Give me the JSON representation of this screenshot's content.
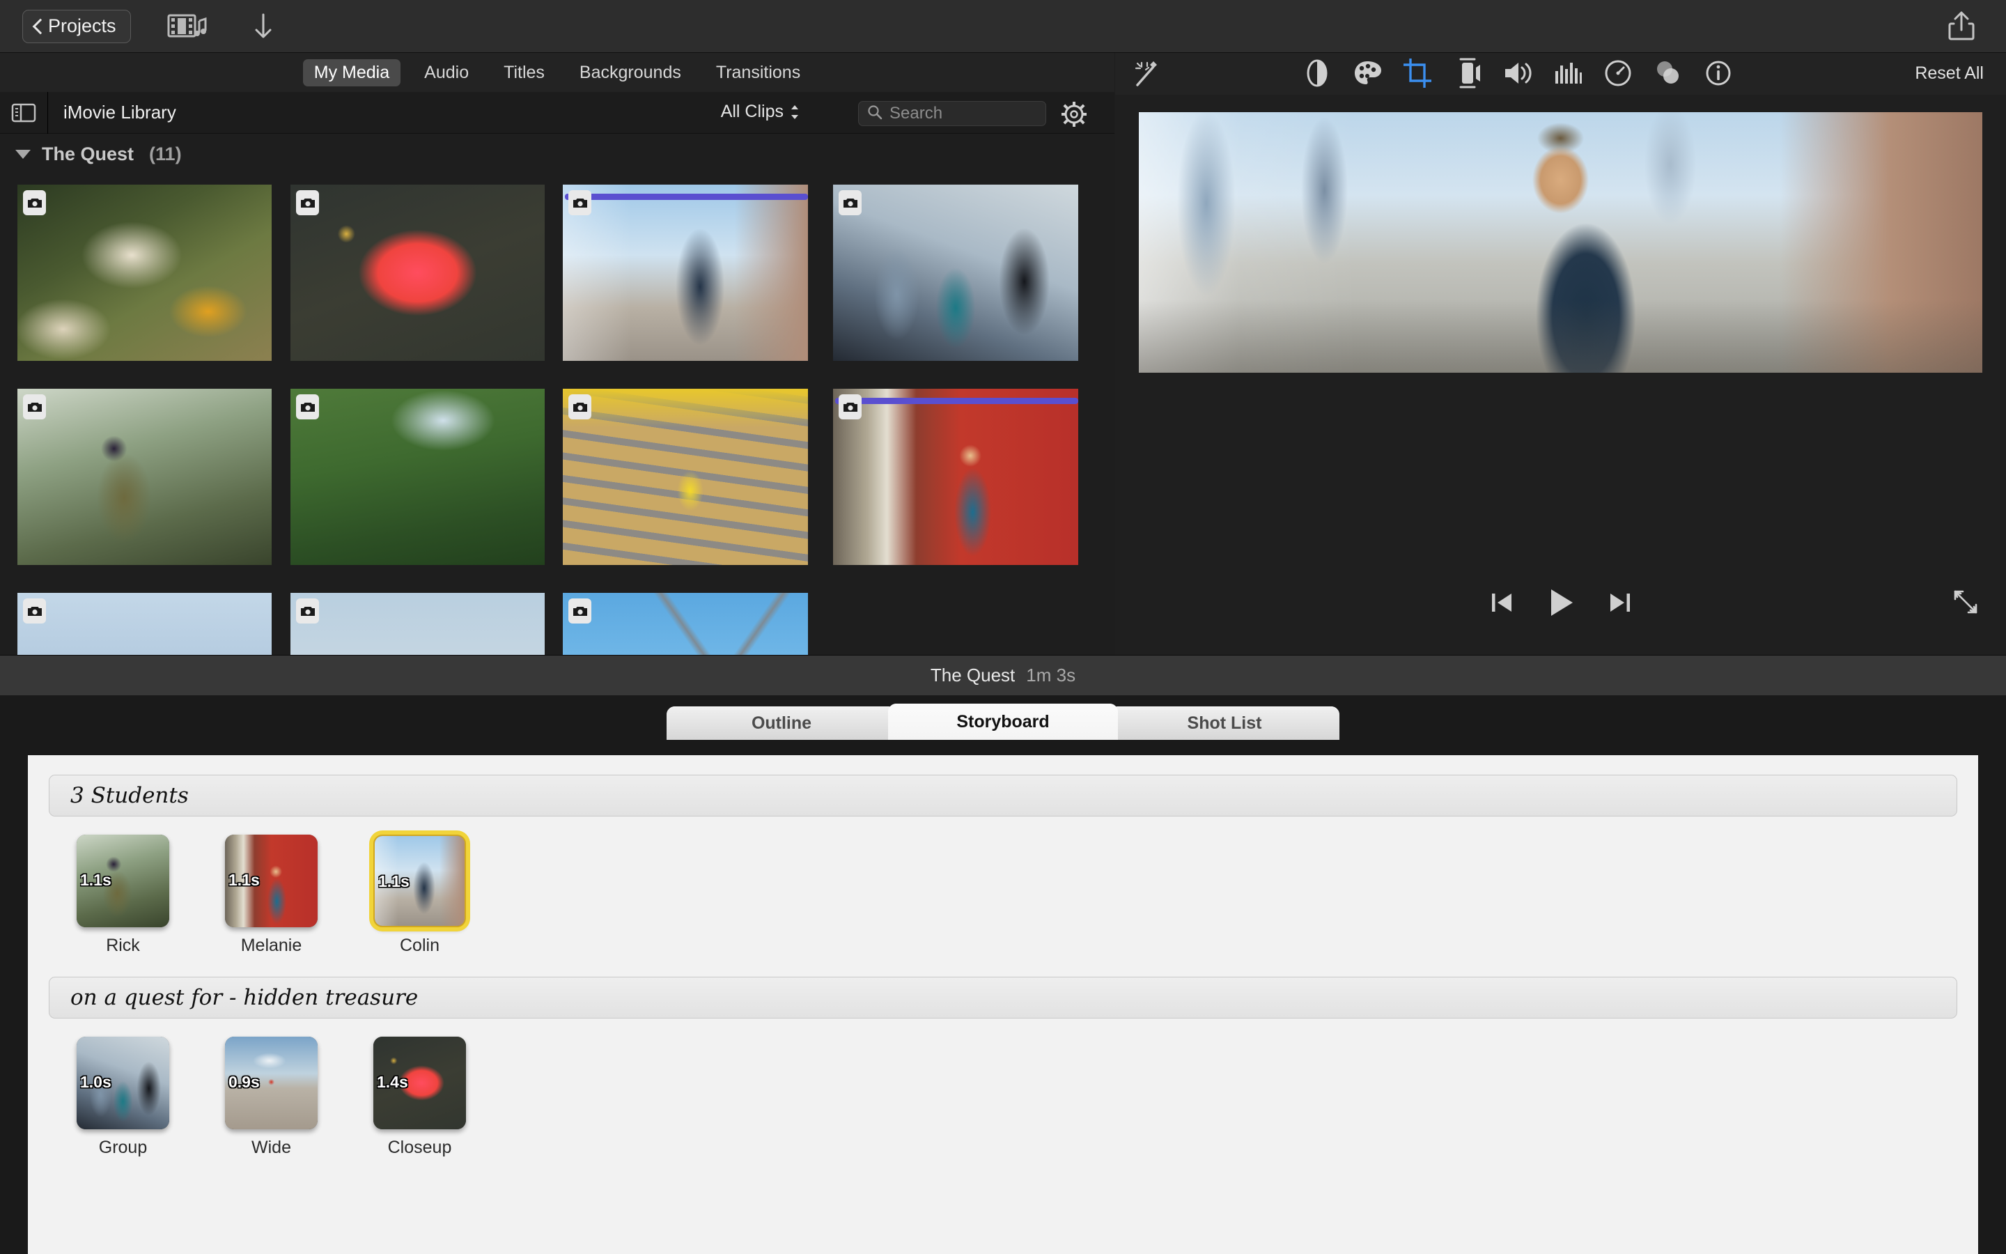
{
  "toolbar": {
    "back_label": "Projects",
    "icons": [
      "film-music-icon",
      "download-arrow-icon",
      "share-icon"
    ]
  },
  "browser": {
    "tabs": [
      {
        "label": "My Media",
        "selected": true
      },
      {
        "label": "Audio",
        "selected": false
      },
      {
        "label": "Titles",
        "selected": false
      },
      {
        "label": "Backgrounds",
        "selected": false
      },
      {
        "label": "Transitions",
        "selected": false
      }
    ],
    "library_title": "iMovie Library",
    "filter_label": "All Clips",
    "search_placeholder": "Search",
    "search_value": "",
    "event": {
      "name": "The Quest",
      "count": "(11)"
    },
    "clips": [
      {
        "id": 1,
        "badge": "camera-icon",
        "used": false
      },
      {
        "id": 2,
        "badge": "camera-icon",
        "used": false
      },
      {
        "id": 3,
        "badge": "camera-icon",
        "used": true
      },
      {
        "id": 4,
        "badge": "camera-icon",
        "used": false
      },
      {
        "id": 5,
        "badge": "camera-icon",
        "used": false
      },
      {
        "id": 6,
        "badge": "camera-icon",
        "used": false
      },
      {
        "id": 7,
        "badge": "camera-icon",
        "used": false
      },
      {
        "id": 8,
        "badge": "camera-icon",
        "used": true
      },
      {
        "id": 9,
        "badge": "camera-icon",
        "used": false
      },
      {
        "id": 10,
        "badge": "camera-icon",
        "used": false
      },
      {
        "id": 11,
        "badge": "camera-icon",
        "used": false
      }
    ]
  },
  "viewer": {
    "adjust_icons": [
      "auto-enhance-icon",
      "color-balance-icon",
      "color-correction-icon",
      "crop-icon",
      "stabilization-icon",
      "volume-icon",
      "equalizer-icon",
      "speed-icon",
      "filter-icon",
      "info-icon"
    ],
    "active_adjust": "crop-icon",
    "reset_label": "Reset All",
    "playback": [
      "skip-back-icon",
      "play-icon",
      "skip-forward-icon"
    ],
    "expand": "expand-icon"
  },
  "storyboard": {
    "project_name": "The Quest",
    "duration": "1m 3s",
    "tabs": [
      {
        "label": "Outline",
        "active": false
      },
      {
        "label": "Storyboard",
        "active": true
      },
      {
        "label": "Shot List",
        "active": false
      }
    ],
    "sections": [
      {
        "heading": "3 Students",
        "shots": [
          {
            "label": "Rick",
            "duration": "1.1s",
            "selected": false
          },
          {
            "label": "Melanie",
            "duration": "1.1s",
            "selected": false
          },
          {
            "label": "Colin",
            "duration": "1.1s",
            "selected": true
          }
        ]
      },
      {
        "heading": "on a quest for - hidden treasure",
        "shots": [
          {
            "label": "Group",
            "duration": "1.0s",
            "selected": false
          },
          {
            "label": "Wide",
            "duration": "0.9s",
            "selected": false
          },
          {
            "label": "Closeup",
            "duration": "1.4s",
            "selected": false
          }
        ]
      }
    ]
  },
  "colors": {
    "accent_selection": "#f1d43a",
    "used_indicator": "#5a4fd0",
    "crop_active": "#3b8ff0",
    "window_bg": "#1e1e1e",
    "toolbar_bg": "#2d2d2d"
  }
}
